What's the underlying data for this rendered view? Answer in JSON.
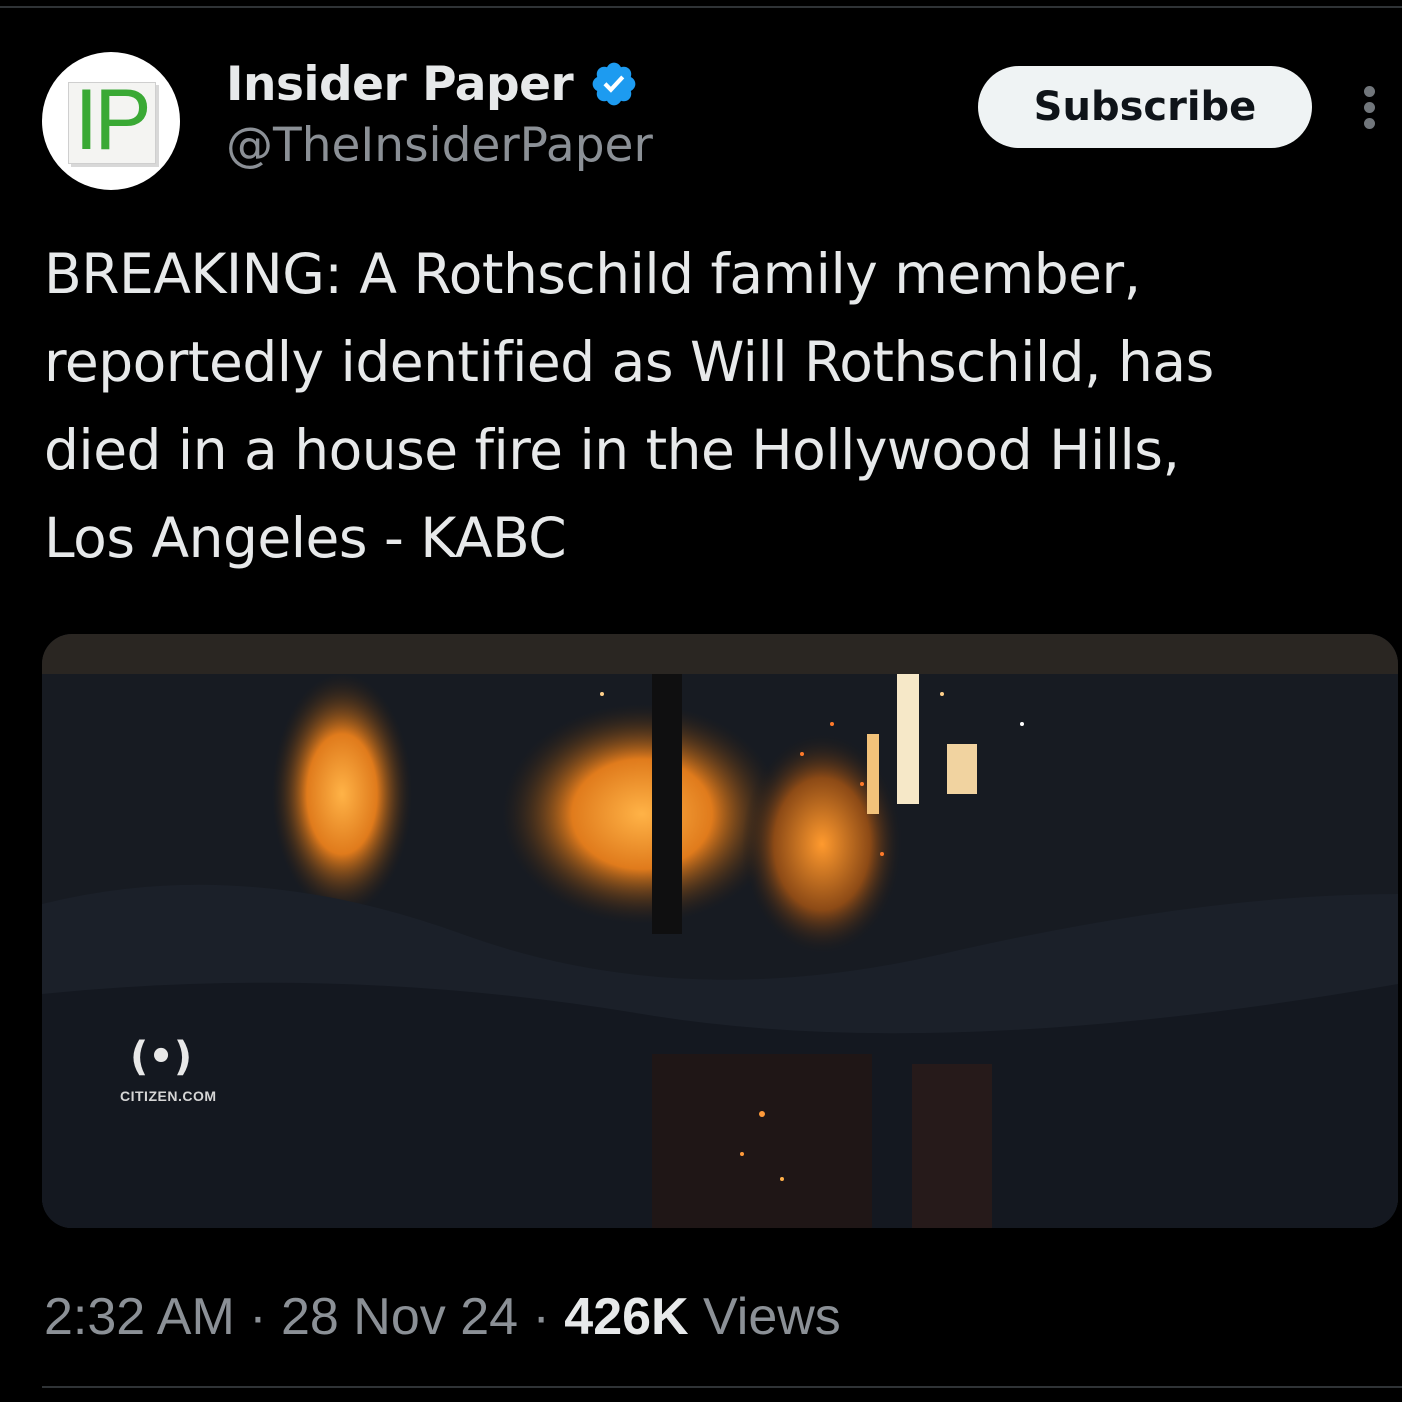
{
  "account": {
    "display_name": "Insider Paper",
    "handle": "@TheInsiderPaper",
    "avatar_text": "IP",
    "verified_icon": "verified-badge-icon",
    "verified_color": "#1d9bf0"
  },
  "actions": {
    "subscribe_label": "Subscribe",
    "more_icon": "more-vertical-icon"
  },
  "tweet": {
    "text": "BREAKING: A Rothschild family member,\nreportedly identified as Will Rothschild, has\ndied in a house fire in the Hollywood Hills,\nLos Angeles - KABC"
  },
  "media": {
    "watermark_symbol": "(•)",
    "watermark_text": "CITIZEN.COM"
  },
  "meta": {
    "time": "2:32 AM",
    "separator": " · ",
    "date": "28 Nov 24",
    "views_count": "426K",
    "views_label": " Views"
  }
}
